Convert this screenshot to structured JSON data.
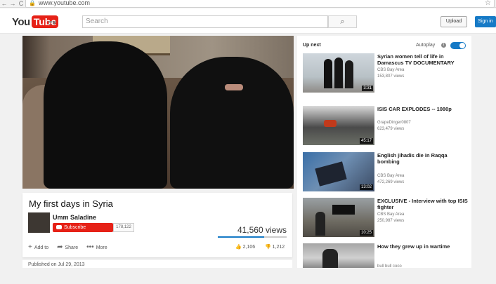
{
  "browser": {
    "url": "www.youtube.com"
  },
  "header": {
    "logo_you": "You",
    "logo_tube": "Tube",
    "search_placeholder": "Search",
    "upload_label": "Upload",
    "signin_label": "Sign in"
  },
  "video": {
    "title": "My first days in Syria",
    "channel": "Umm Saladine",
    "subscribe_label": "Subscribe",
    "subscriber_count": "178,122",
    "views": "41,560 views",
    "like_share_fraction": 0.67,
    "actions": {
      "add_to": "Add to",
      "share": "Share",
      "more": "More"
    },
    "likes": "2,106",
    "dislikes": "1,212",
    "published": "Published on Jul 29, 2013"
  },
  "sidebar": {
    "upnext_label": "Up next",
    "autoplay_label": "Autoplay",
    "autoplay_on": true,
    "items": [
      {
        "title": "Syrian women tell of life in Damascus TV DOCUMENTARY",
        "channel": "CBS Bay Area",
        "views": "153,807 views",
        "duration": "3:31"
      },
      {
        "title": "ISIS CAR EXPLODES -- 1080p",
        "channel": "GrapeDinger0807",
        "views": "623,479 views",
        "duration": "45:17"
      },
      {
        "title": "English jihadis die in Raqqa bombing",
        "channel": "CBS Bay Area",
        "views": "472,269 views",
        "duration": "13:02"
      },
      {
        "title": "EXCLUSIVE - Interview with top ISIS fighter",
        "channel": "CBS Bay Area",
        "views": "250,987 views",
        "duration": "10:25"
      },
      {
        "title": "How they grew up in wartime",
        "channel": "bull bull coco",
        "views": "",
        "duration": ""
      }
    ]
  },
  "colors": {
    "youtube_red": "#e62117",
    "accent_blue": "#167ac6"
  }
}
